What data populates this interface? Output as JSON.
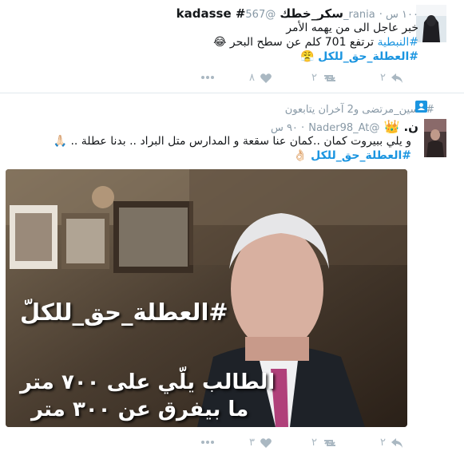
{
  "tweets": [
    {
      "user_name": "kadasse #سكر_خطك",
      "user_handle": "@567_rania",
      "time": "١٠٠ س",
      "line1": "خبر عاجل الى من يهمه الأمر",
      "line2_tag": "#النبطية",
      "line2_rest": " ترتفع 701 كلم عن سطح البحر",
      "emoji1": "😂",
      "line3_tag": "#العطلة_حق_للكل",
      "emoji2": "😤",
      "actions": {
        "reply_count": "٢",
        "retweet_count": "٢",
        "like_count": "٨",
        "more_icon": "more-dots-icon"
      }
    },
    {
      "follow_context": "#حسين_مرتضى و2 آخران يتابعون",
      "user_name": "ن.",
      "user_emoji": "👑",
      "user_handle": "@Nader98_At",
      "time": "٩٠ س",
      "line1": "و يلي ببيروت كمان ..كمان عنا سقعة و المدارس متل البراد .. بدنا عطلة ..",
      "emoji1": "🙏🏻",
      "line2_tag": "#العطلة_حق_للكل",
      "emoji2": "👌🏻",
      "media": {
        "hashtag": "#العطلة_حق_للكلّ",
        "caption1": "الطالب يلّي على ٧٠٠ متر",
        "caption2": "ما بيفرق عن ٣٠٠ متر"
      },
      "actions": {
        "reply_count": "٢",
        "retweet_count": "٢",
        "like_count": "٣",
        "more_icon": "more-dots-icon"
      }
    }
  ],
  "colors": {
    "link": "#1b95e0",
    "muted": "#8899a6",
    "icon": "#aab8c2"
  }
}
